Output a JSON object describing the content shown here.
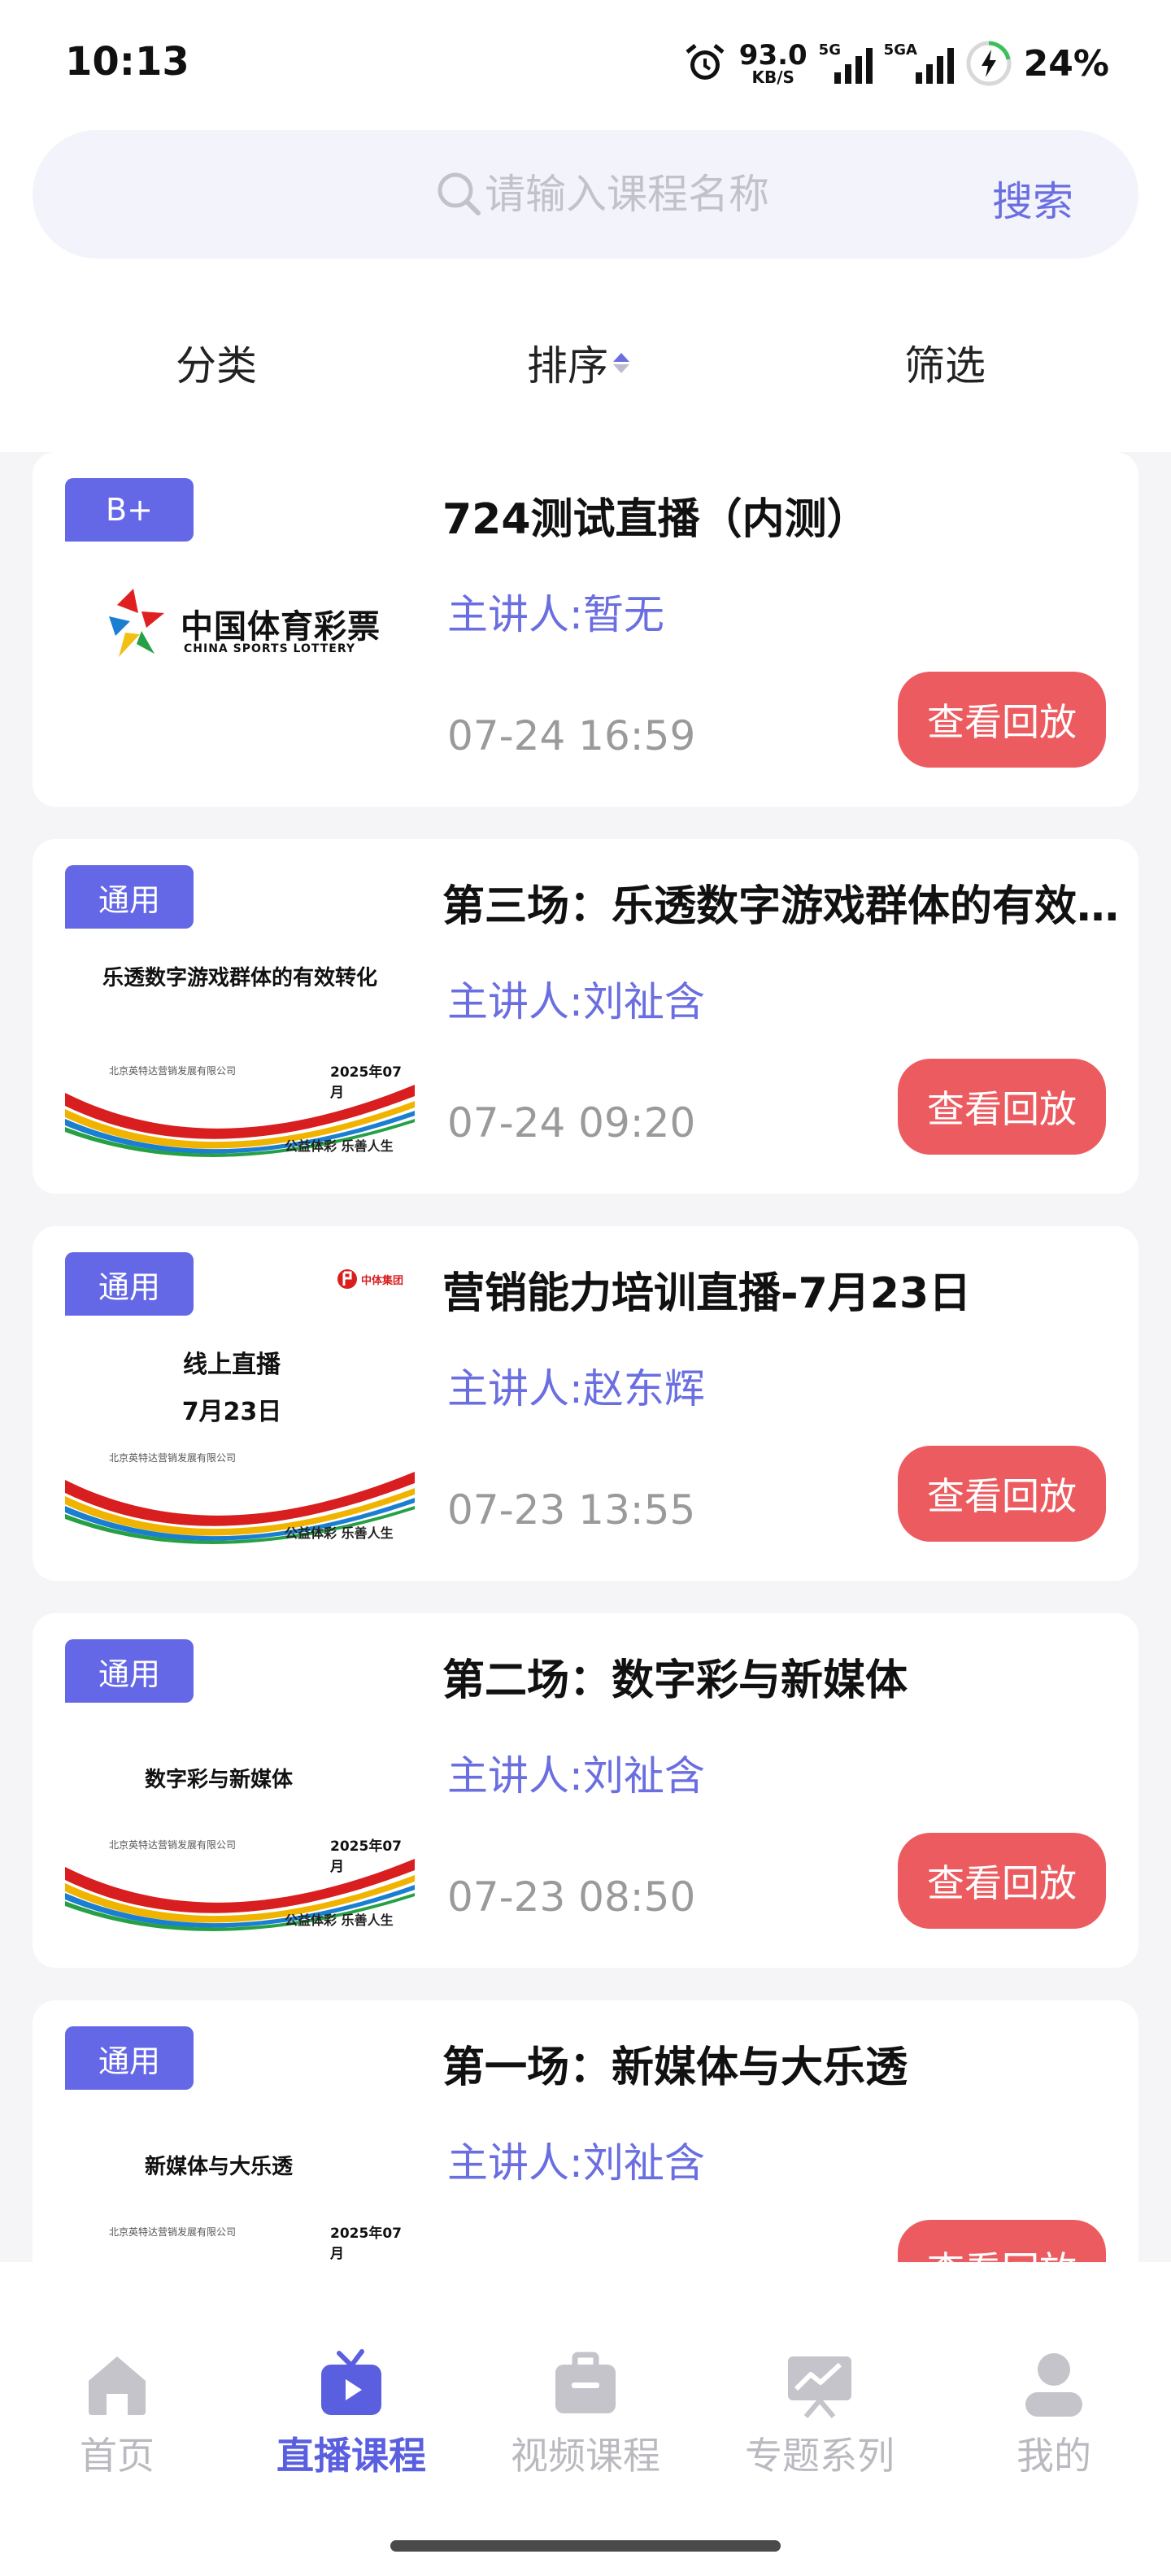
{
  "status_bar": {
    "time": "10:13",
    "net_speed_value": "93.0",
    "net_speed_unit": "KB/S",
    "signal1_label": "5G",
    "signal2_label": "5GA",
    "battery": "24%"
  },
  "search": {
    "placeholder": "请输入课程名称",
    "button_label": "搜索"
  },
  "filters": {
    "category": "分类",
    "sort": "排序",
    "filter": "筛选"
  },
  "courses": [
    {
      "tag": "B+",
      "title": "724测试直播（内测）",
      "speaker": "主讲人:暂无",
      "date": "07-24 16:59",
      "button": "查看回放",
      "thumb": {
        "logo_cn": "中国体育彩票",
        "logo_en": "CHINA SPORTS LOTTERY"
      }
    },
    {
      "tag": "通用",
      "title": "第三场：乐透数字游戏群体的有效转化",
      "speaker": "主讲人:刘祉含",
      "date": "07-24 09:20",
      "button": "查看回放",
      "thumb": {
        "caption": "乐透数字游戏群体的有效转化",
        "company": "北京英特达营销发展有限公司",
        "month": "2025年07月",
        "slogan": "公益体彩 乐善人生"
      }
    },
    {
      "tag": "通用",
      "title": "营销能力培训直播-7月23日",
      "speaker": "主讲人:赵东辉",
      "date": "07-23 13:55",
      "button": "查看回放",
      "thumb": {
        "caption_line1": "线上直播",
        "caption_line2": "7月23日",
        "company": "北京英特达营销发展有限公司",
        "slogan": "公益体彩 乐善人生",
        "brand": "中体集团"
      }
    },
    {
      "tag": "通用",
      "title": "第二场：数字彩与新媒体",
      "speaker": "主讲人:刘祉含",
      "date": "07-23 08:50",
      "button": "查看回放",
      "thumb": {
        "caption": "数字彩与新媒体",
        "company": "北京英特达营销发展有限公司",
        "month": "2025年07月",
        "slogan": "公益体彩 乐善人生"
      }
    },
    {
      "tag": "通用",
      "title": "第一场：新媒体与大乐透",
      "speaker": "主讲人:刘祉含",
      "date": "",
      "button": "查看回放",
      "thumb": {
        "caption": "新媒体与大乐透",
        "company": "北京英特达营销发展有限公司",
        "month": "2025年07月"
      }
    }
  ],
  "tabbar": [
    {
      "label": "首页",
      "icon": "home-icon"
    },
    {
      "label": "直播课程",
      "icon": "live-tv-icon",
      "active": true
    },
    {
      "label": "视频课程",
      "icon": "briefcase-icon"
    },
    {
      "label": "专题系列",
      "icon": "presentation-chart-icon"
    },
    {
      "label": "我的",
      "icon": "user-icon"
    }
  ],
  "colors": {
    "accent": "#6467e6",
    "replay_button": "#ec5b5f",
    "speaker_text": "#6a6ee0"
  }
}
